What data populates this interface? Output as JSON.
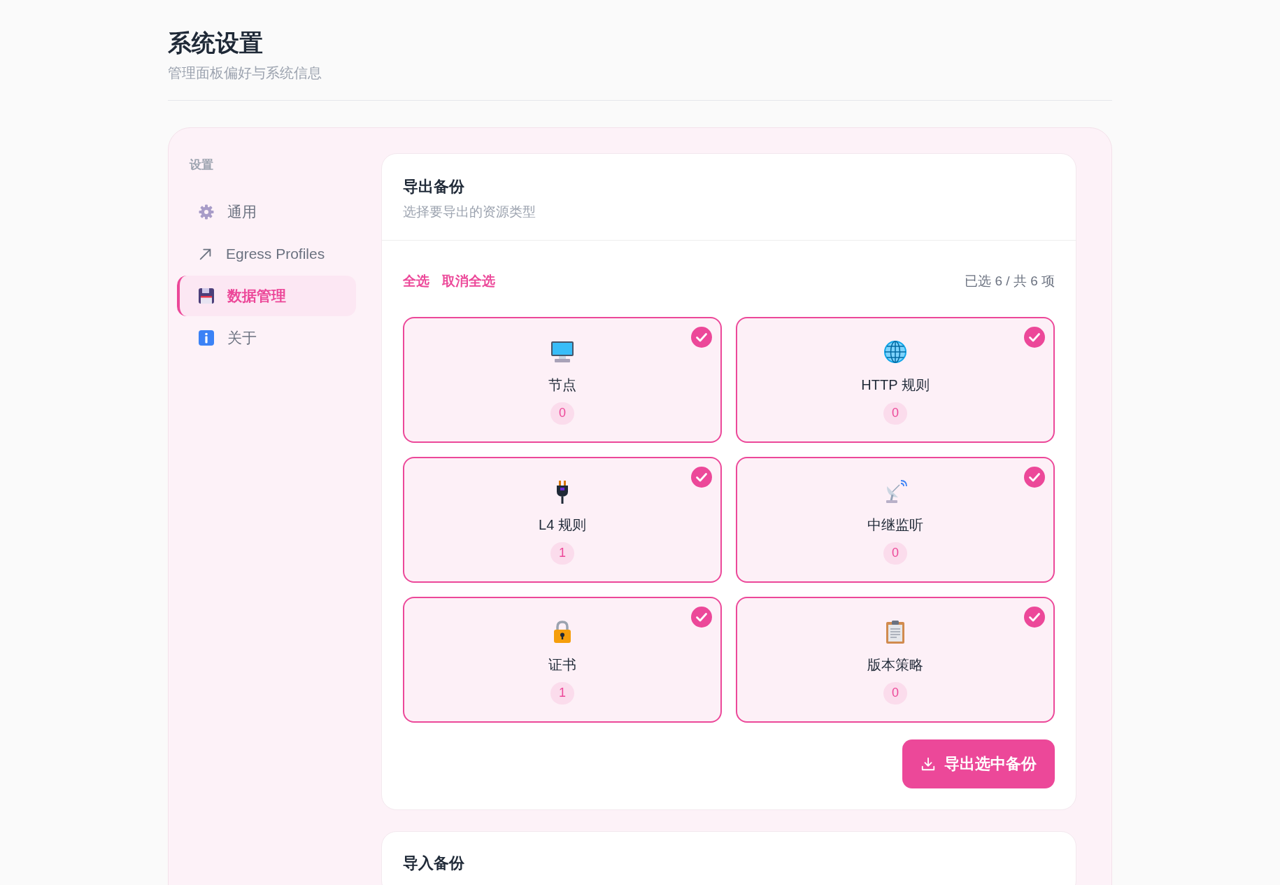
{
  "page": {
    "title": "系统设置",
    "subtitle": "管理面板偏好与系统信息"
  },
  "sidebar": {
    "heading": "设置",
    "items": [
      {
        "label": "通用",
        "selected": false
      },
      {
        "label": "Egress Profiles",
        "selected": false
      },
      {
        "label": "数据管理",
        "selected": true
      },
      {
        "label": "关于",
        "selected": false
      }
    ]
  },
  "export": {
    "title": "导出备份",
    "subtitle": "选择要导出的资源类型",
    "select_all": "全选",
    "deselect_all": "取消全选",
    "summary": "已选 6 / 共 6 项",
    "resources": [
      {
        "label": "节点",
        "count": "0",
        "checked": true
      },
      {
        "label": "HTTP 规则",
        "count": "0",
        "checked": true
      },
      {
        "label": "L4 规则",
        "count": "1",
        "checked": true
      },
      {
        "label": "中继监听",
        "count": "0",
        "checked": true
      },
      {
        "label": "证书",
        "count": "1",
        "checked": true
      },
      {
        "label": "版本策略",
        "count": "0",
        "checked": true
      }
    ],
    "button": "导出选中备份"
  },
  "import": {
    "title": "导入备份"
  }
}
